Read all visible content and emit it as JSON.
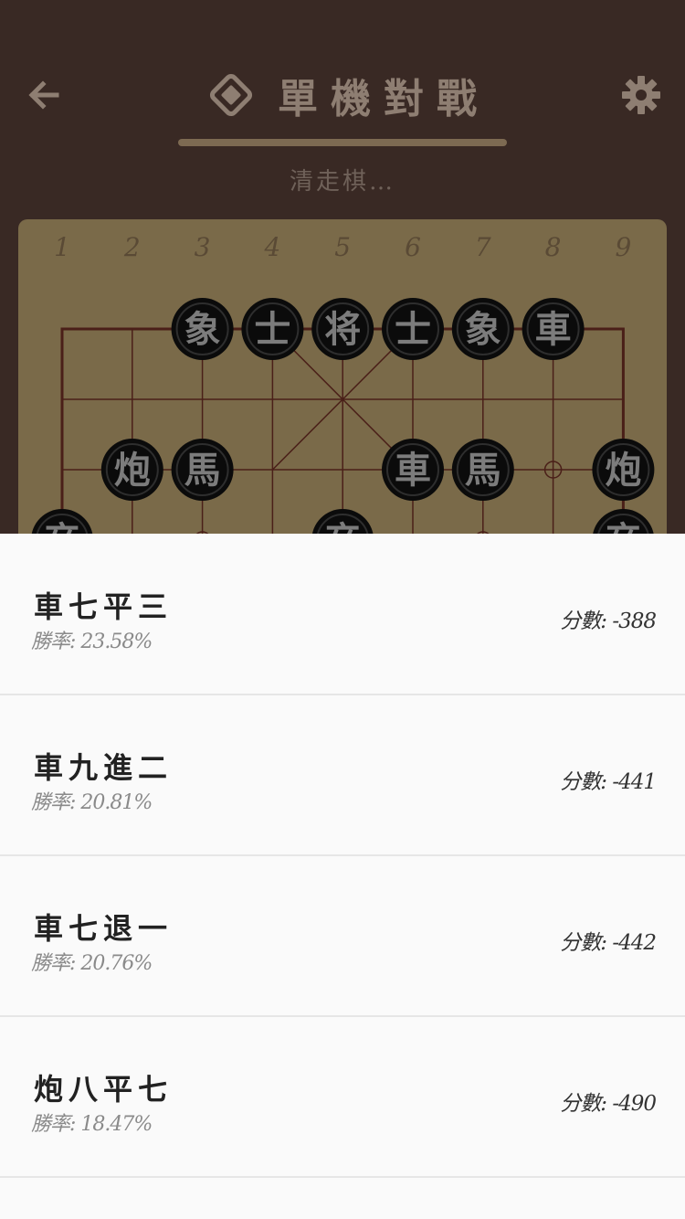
{
  "header": {
    "title": "單機對戰",
    "status": "清走棋…",
    "progress_fraction": 1.0
  },
  "icons": {
    "back": "arrow-left-icon",
    "logo": "diamond-logo-icon",
    "settings": "gear-icon"
  },
  "board": {
    "file_numbers": [
      "1",
      "2",
      "3",
      "4",
      "5",
      "6",
      "7",
      "8",
      "9"
    ],
    "pieces": [
      {
        "label": "象",
        "file": 3,
        "rank": 1
      },
      {
        "label": "士",
        "file": 4,
        "rank": 1
      },
      {
        "label": "将",
        "file": 5,
        "rank": 1
      },
      {
        "label": "士",
        "file": 6,
        "rank": 1
      },
      {
        "label": "象",
        "file": 7,
        "rank": 1
      },
      {
        "label": "車",
        "file": 8,
        "rank": 1
      },
      {
        "label": "炮",
        "file": 2,
        "rank": 3
      },
      {
        "label": "馬",
        "file": 3,
        "rank": 3
      },
      {
        "label": "車",
        "file": 6,
        "rank": 3
      },
      {
        "label": "馬",
        "file": 7,
        "rank": 3
      },
      {
        "label": "炮",
        "file": 9,
        "rank": 3
      },
      {
        "label": "卒",
        "file": 1,
        "rank": 4
      },
      {
        "label": "卒",
        "file": 5,
        "rank": 4
      },
      {
        "label": "卒",
        "file": 9,
        "rank": 4
      }
    ],
    "markers": [
      {
        "file": 8,
        "rank": 3
      },
      {
        "file": 3,
        "rank": 4
      },
      {
        "file": 7,
        "rank": 4
      }
    ]
  },
  "moves": [
    {
      "name": "車七平三",
      "rate": "勝率: 23.58%",
      "score": "分數: -388"
    },
    {
      "name": "車九進二",
      "rate": "勝率: 20.81%",
      "score": "分數: -441"
    },
    {
      "name": "車七退一",
      "rate": "勝率: 20.76%",
      "score": "分數: -442"
    },
    {
      "name": "炮八平七",
      "rate": "勝率: 18.47%",
      "score": "分數: -490"
    }
  ]
}
